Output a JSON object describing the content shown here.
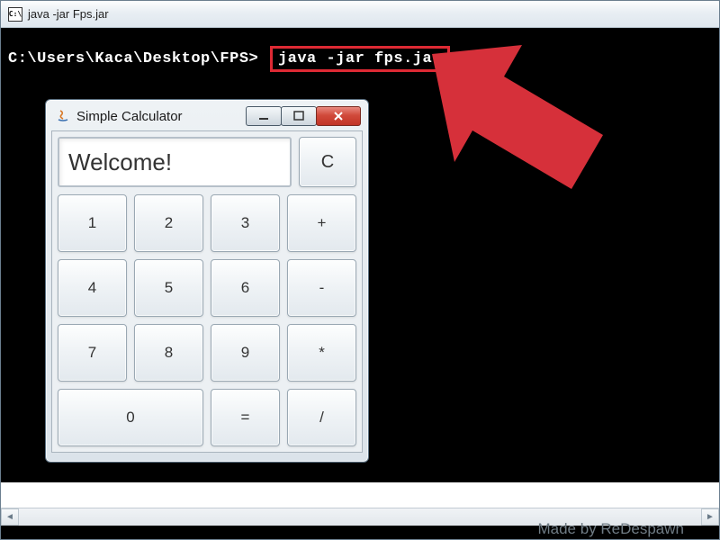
{
  "console": {
    "icon_label": "C:\\",
    "title": "java  -jar Fps.jar",
    "prompt": "C:\\Users\\Kaca\\Desktop\\FPS>",
    "command": "java -jar fps.jar"
  },
  "calculator": {
    "title": "Simple Calculator",
    "display": "Welcome!",
    "clear_label": "C",
    "buttons": {
      "r1c1": "1",
      "r1c2": "2",
      "r1c3": "3",
      "r1c4": "+",
      "r2c1": "4",
      "r2c2": "5",
      "r2c3": "6",
      "r2c4": "-",
      "r3c1": "7",
      "r3c2": "8",
      "r3c3": "9",
      "r3c4": "*",
      "r4c1": "0",
      "r4c3": "=",
      "r4c4": "/"
    },
    "window_controls": {
      "min": "—",
      "max": "▢",
      "close": "✕"
    }
  },
  "footer": {
    "credit": "Made by ReDespawn"
  },
  "colors": {
    "highlight": "#de2a34",
    "arrow": "#d6303a"
  }
}
